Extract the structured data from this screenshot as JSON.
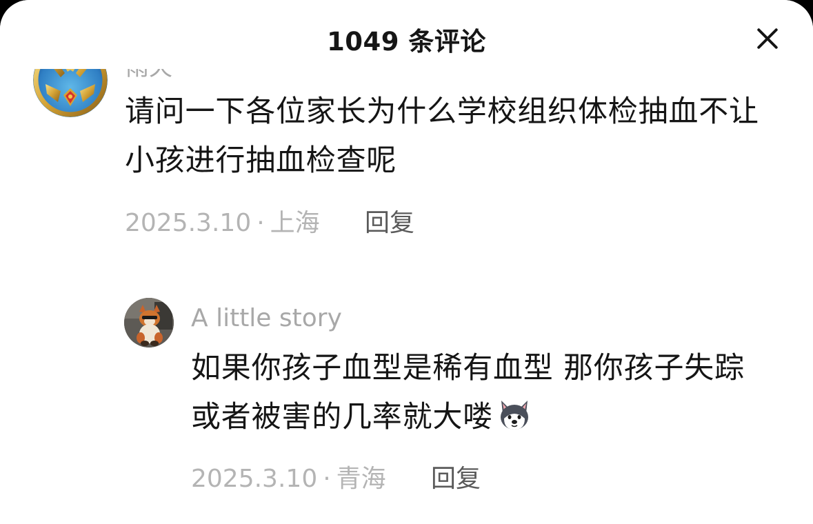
{
  "header": {
    "title": "1049 条评论"
  },
  "comment": {
    "username_partial": "雨天",
    "text_line1": "请问一下各位家长为什么学校组织体检抽血不让",
    "text_line2": "小孩进行抽血检查呢",
    "date": "2025.3.10",
    "location": "上海",
    "separator": "·",
    "reply_label": "回复"
  },
  "reply": {
    "username": "A little story",
    "text_line1": "如果你孩子血型是稀有血型 那你孩子失踪",
    "text_line2": "或者被害的几率就大喽",
    "emoji_icon": "husky-dog-emoji",
    "date": "2025.3.10",
    "location": "青海",
    "separator": "·",
    "reply_label": "回复"
  }
}
